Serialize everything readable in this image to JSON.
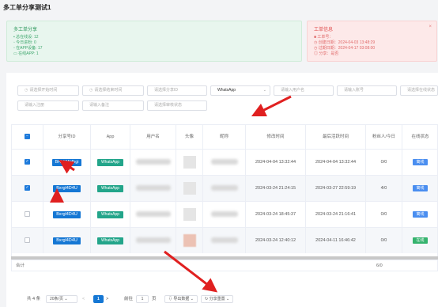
{
  "page_title": "多工单分享测试1",
  "stats_card": {
    "title": "多工单分享",
    "rows": [
      "总在线设: 12",
      "今日进粉: 0",
      "在APP设备: 17",
      "在线APP: 1"
    ]
  },
  "info_card": {
    "title": "工单信息",
    "close": "×",
    "rows": [
      "工单号：",
      "创建日期：2024-04-03 13:48:29",
      "过期日期：2024-04-17 03:08:00",
      "分享：是否"
    ]
  },
  "filters": {
    "start_time": "请选择开始时间",
    "end_time": "请选择结束时间",
    "share_id": "请选择分享ID",
    "app_selected": "WhatsApp",
    "user_name": "请输入用户名",
    "account": "请输入账号",
    "status": "请选择在线状态",
    "register": "请输入注册",
    "remark": "请输入备注",
    "review": "请选择审核状态"
  },
  "table": {
    "headers": [
      "分享号ID",
      "App",
      "用户名",
      "头像",
      "昵称",
      "修改时间",
      "最后活跃时间",
      "粉丝人/今日",
      "在线状态"
    ],
    "rows": [
      {
        "id": "BHbYWdhgi",
        "app": "WhatsApp",
        "modified": "2024-04-04 13:32:44",
        "last_active": "2024-04-04 13:32:44",
        "fans": "0/0",
        "status": "离线",
        "checked": true
      },
      {
        "id": "Bxrgl4D4U",
        "app": "WhatsApp",
        "modified": "2024-03-24 21:24:15",
        "last_active": "2024-03-27 22:59:19",
        "fans": "4/0",
        "status": "离线",
        "checked": true
      },
      {
        "id": "Bxrgl4D4U",
        "app": "WhatsApp",
        "modified": "2024-03-24 18:45:37",
        "last_active": "2024-03-24 21:16:41",
        "fans": "0/0",
        "status": "离线",
        "checked": false
      },
      {
        "id": "Bxrgl4D4U",
        "app": "WhatsApp",
        "modified": "2024-03-24 12:40:12",
        "last_active": "2024-04-11 16:46:42",
        "fans": "0/0",
        "status": "在线",
        "checked": false
      }
    ],
    "sum_label": "合计",
    "sum_value": "6/0"
  },
  "pager": {
    "total": "共 4 条",
    "page_size": "20条/页",
    "prev": "<",
    "page": "1",
    "next": ">",
    "goto_label": "前往",
    "goto_value": "1",
    "goto_suffix": "页",
    "export_btn": "导出数据",
    "share_btn": "分享重置"
  },
  "colors": {
    "primary": "#1577d4",
    "app_tag": "#23a58a",
    "stats_bg": "#e8f6ee",
    "info_bg": "#fde9e9",
    "arrow": "#e02020"
  }
}
